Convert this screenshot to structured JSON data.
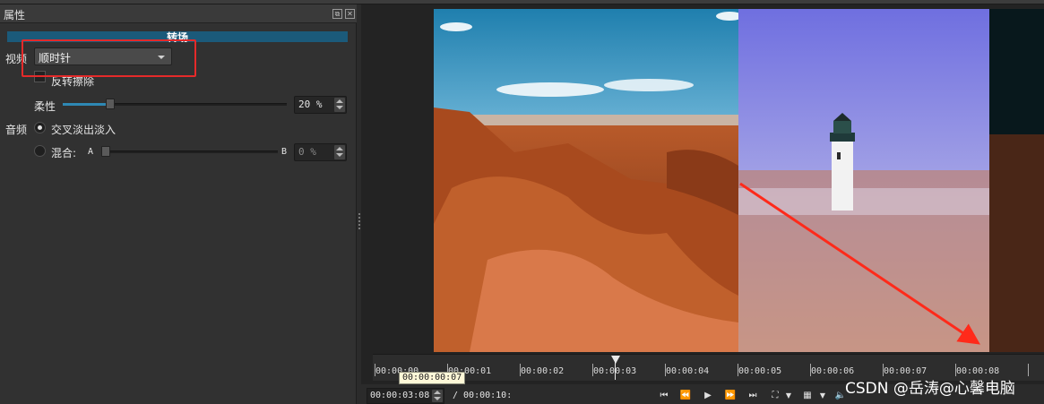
{
  "panel": {
    "title": "属性",
    "section_title": "转场",
    "video_label": "视频",
    "direction_value": "顺时针",
    "reverse_wipe_label": "反转擦除",
    "softness_label": "柔性",
    "softness_value": "20 %",
    "softness_percent": 20,
    "audio_label": "音频",
    "crossfade_label": "交叉淡出淡入",
    "mix_label": "混合:",
    "mix_a": "A",
    "mix_b": "B",
    "mix_value": "0 %"
  },
  "player": {
    "ruler_labels": [
      "00:00:00",
      "00:00:01",
      "00:00:02",
      "00:00:03",
      "00:00:04",
      "00:00:05",
      "00:00:06",
      "00:00:07",
      "00:00:08"
    ],
    "tooltip": "00:00:00:07",
    "current_time": "00:00:03:08",
    "total_time": "/ 00:00:10:",
    "watermark": "CSDN @岳涛@心馨电脑"
  },
  "icons": {
    "float": "float-icon",
    "close": "close-icon",
    "skip_start": "skip-to-start-icon",
    "rewind": "rewind-icon",
    "play": "play-icon",
    "fast_forward": "fast-forward-icon",
    "skip_end": "skip-to-end-icon",
    "zoom": "zoom-icon",
    "grid": "grid-icon",
    "volume": "volume-icon"
  },
  "colors": {
    "section_bar": "#1b5a7a",
    "highlight_box": "#e52a2a",
    "annotation_arrow": "#ff2a1a"
  }
}
